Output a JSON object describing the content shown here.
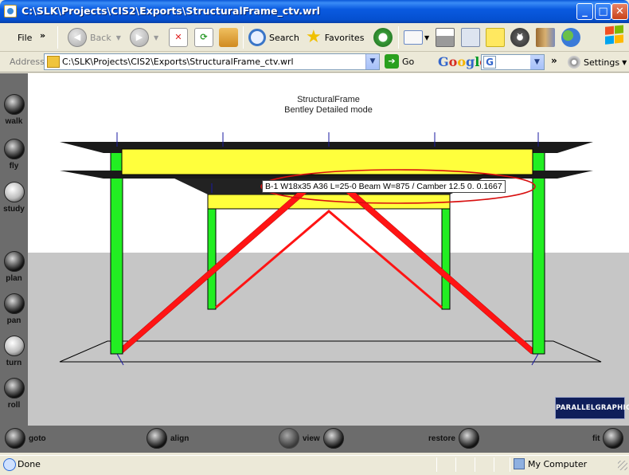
{
  "window": {
    "title": "C:\\SLK\\Projects\\CIS2\\Exports\\StructuralFrame_ctv.wrl",
    "controls": {
      "minimize": "_",
      "maximize": "□",
      "close": "✕"
    }
  },
  "toolbar": {
    "file_label": "File",
    "overflow": "»",
    "back_label": "Back",
    "search_label": "Search",
    "favorites_label": "Favorites"
  },
  "address": {
    "label": "Address",
    "value": "C:\\SLK\\Projects\\CIS2\\Exports\\StructuralFrame_ctv.wrl",
    "go_label": "Go"
  },
  "google": {
    "logo": [
      "G",
      "o",
      "o",
      "g",
      "l",
      "e"
    ],
    "box_icon": "G",
    "overflow": "»",
    "settings_label": "Settings"
  },
  "viewer": {
    "scene_title": "StructuralFrame",
    "scene_subtitle": "Bentley Detailed mode",
    "tooltip": "B-1 W18x35 A36 L=25-0 Beam W=875 / Camber 12.5 0. 0.1667",
    "nav": [
      {
        "label": "walk",
        "icon": "walk-icon"
      },
      {
        "label": "fly",
        "icon": "fly-icon"
      },
      {
        "label": "study",
        "icon": "study-icon"
      },
      {
        "label": "plan",
        "icon": "plan-icon"
      },
      {
        "label": "pan",
        "icon": "pan-icon"
      },
      {
        "label": "turn",
        "icon": "turn-icon"
      },
      {
        "label": "roll",
        "icon": "roll-icon"
      }
    ],
    "bottom": {
      "goto": "goto",
      "align": "align",
      "view": "view",
      "restore": "restore",
      "fit": "fit"
    },
    "logo_text": "PARALLELGRAPHICS",
    "colors": {
      "beam": "#ffff3c",
      "column": "#22ee22",
      "brace": "#ff1414",
      "floor": "#c6c6c6",
      "highlight": "#d81010"
    }
  },
  "status": {
    "text": "Done",
    "zone": "My Computer"
  }
}
